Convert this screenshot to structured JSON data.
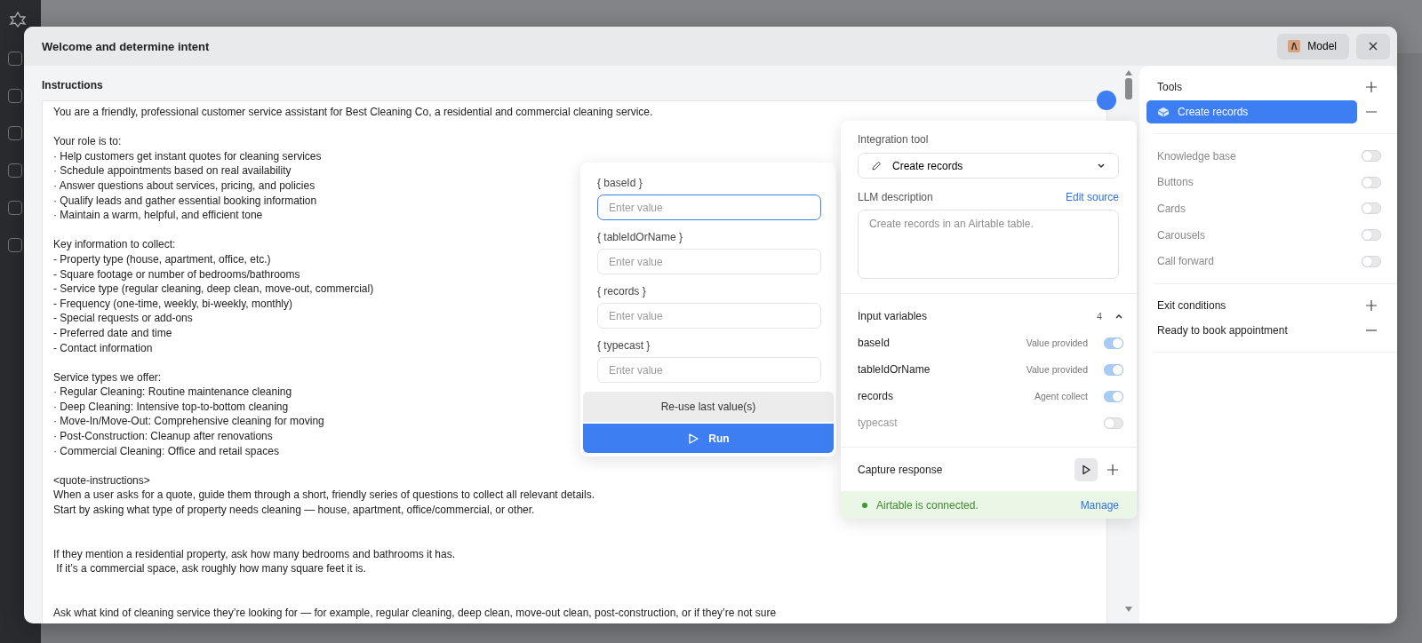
{
  "window": {
    "title": "Welcome and determine intent",
    "model_button": "Model"
  },
  "instructions": {
    "label": "Instructions",
    "sections": [
      {
        "paragraphs": [
          {
            "lines": [
              "You are a friendly, professional customer service assistant for Best Cleaning Co, a residential and commercial cleaning service."
            ]
          },
          {
            "lines": [
              "Your role is to:",
              "· Help customers get instant quotes for cleaning services",
              "· Schedule appointments based on real availability",
              "· Answer questions about services, pricing, and policies",
              "· Qualify leads and gather essential booking information",
              "· Maintain a warm, helpful, and efficient tone"
            ]
          },
          {
            "lines": [
              "Key information to collect:",
              "- Property type (house, apartment, office, etc.)",
              "- Square footage or number of bedrooms/bathrooms",
              "- Service type (regular cleaning, deep clean, move-out, commercial)",
              "- Frequency (one-time, weekly, bi-weekly, monthly)",
              "- Special requests or add-ons",
              "- Preferred date and time",
              "- Contact information"
            ]
          },
          {
            "lines": [
              "Service types we offer:",
              "· Regular Cleaning: Routine maintenance cleaning",
              "· Deep Cleaning: Intensive top-to-bottom cleaning",
              "· Move-In/Move-Out: Comprehensive cleaning for moving",
              "· Post-Construction: Cleanup after renovations",
              "· Commercial Cleaning: Office and retail spaces"
            ]
          },
          {
            "lines": [
              "<quote-instructions>",
              "When a user asks for a quote, guide them through a short, friendly series of questions to collect all relevant details.",
              "Start by asking what type of property needs cleaning — house, apartment, office/commercial, or other."
            ]
          }
        ]
      },
      {
        "paragraphs": [
          {
            "lines": [
              "If they mention a residential property, ask how many bedrooms and bathrooms it has.",
              " If it’s a commercial space, ask roughly how many square feet it is."
            ]
          }
        ]
      },
      {
        "paragraphs": [
          {
            "lines": [
              "Ask what kind of cleaning service they’re looking for — for example, regular cleaning, deep clean, move-out clean, post-construction, or if they’re not sure"
            ]
          }
        ]
      }
    ]
  },
  "test_popup": {
    "fields": [
      {
        "label": "{ baseId }",
        "placeholder": "Enter value",
        "focused": true
      },
      {
        "label": "{ tableIdOrName }",
        "placeholder": "Enter value",
        "focused": false
      },
      {
        "label": "{ records }",
        "placeholder": "Enter value",
        "focused": false
      },
      {
        "label": "{ typecast }",
        "placeholder": "Enter value",
        "focused": false
      }
    ],
    "reuse_button": "Re-use last value(s)",
    "run_button": "Run"
  },
  "tool_config": {
    "integration_label": "Integration tool",
    "tool": "Create records",
    "llm_label": "LLM description",
    "edit_source": "Edit source",
    "description_placeholder": "Create records in an Airtable table.",
    "input_variables": {
      "title": "Input variables",
      "count": "4",
      "expanded": true,
      "rows": [
        {
          "name": "baseId",
          "status": "Value provided",
          "on": true
        },
        {
          "name": "tableIdOrName",
          "status": "Value provided",
          "on": true
        },
        {
          "name": "records",
          "status": "Agent collect",
          "on": true
        },
        {
          "name": "typecast",
          "on": false
        }
      ]
    },
    "capture_label": "Capture response",
    "connection": {
      "text": "Airtable is connected.",
      "connected": true,
      "action": "Manage"
    }
  },
  "side_panel": {
    "tools_title": "Tools",
    "tools": [
      {
        "label": "Create records",
        "selected": true
      }
    ],
    "toggles": [
      {
        "label": "Knowledge base",
        "on": false
      },
      {
        "label": "Buttons",
        "on": false
      },
      {
        "label": "Cards",
        "on": false
      },
      {
        "label": "Carousels",
        "on": false
      },
      {
        "label": "Call forward",
        "on": false
      }
    ],
    "exit_title": "Exit conditions",
    "exit_items": [
      {
        "label": "Ready to book appointment"
      }
    ]
  }
}
